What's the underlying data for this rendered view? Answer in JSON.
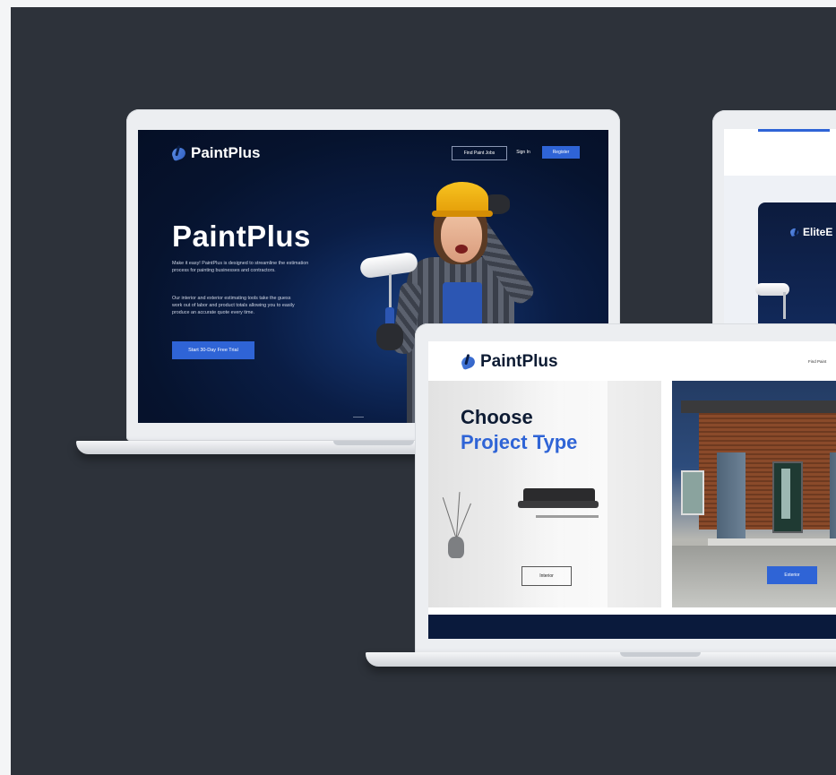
{
  "laptop1": {
    "brand": "PaintPlus",
    "nav": {
      "find_job": "Find Paint Jobs",
      "sign_in": "Sign In",
      "register": "Register"
    },
    "hero_title": "PaintPlus",
    "paragraph1": "Make it easy! PaintPlus is designed to streamline the estimation process for painting businesses and contractors.",
    "paragraph2": "Our interior and exterior estimating tools take the guess work out of labor and product totals allowing you to easily produce an accurate quote every time.",
    "cta": "Start 30-Day Free Trial"
  },
  "laptop2": {
    "brand": "EliteE"
  },
  "laptop3": {
    "brand": "PaintPlus",
    "nav_partial": "Find Paint",
    "heading_line1": "Choose",
    "heading_line2": "Project Type",
    "interior_button": "Interior",
    "exterior_button": "Exterior"
  },
  "colors": {
    "stage_bg": "#2d323a",
    "accent_blue": "#2f64d6",
    "navy": "#0a1d45"
  }
}
